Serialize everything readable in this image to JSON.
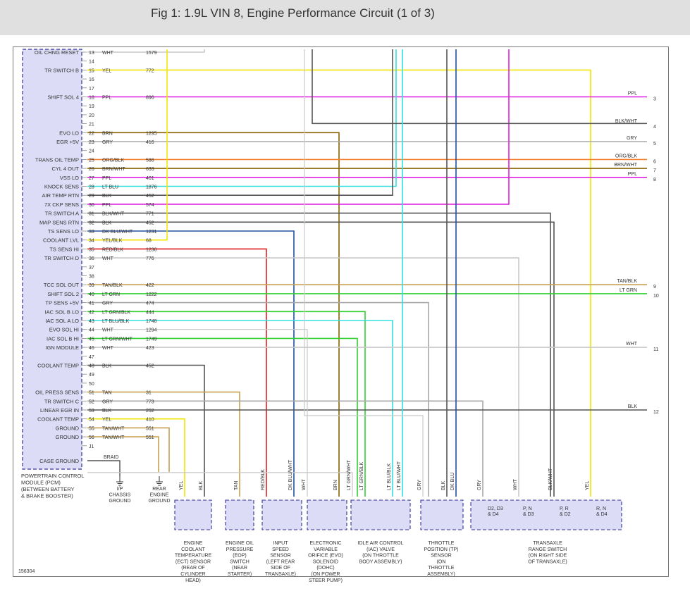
{
  "title": "Fig 1: 1.9L VIN 8, Engine Performance Circuit (1 of 3)",
  "figure_id": "156304",
  "pcm_label": [
    "POWERTRAIN CONTROL",
    "MODULE (PCM)",
    "(BETWEEN BATTERY",
    "& BRAKE BOOSTER)"
  ],
  "case_ground": "CASE GROUND",
  "braid": "BRAID",
  "pins": [
    {
      "n": "13",
      "label": "OIL CHNG RESET",
      "color": "WHT",
      "circuit": "1579"
    },
    {
      "n": "14",
      "label": "",
      "color": "",
      "circuit": ""
    },
    {
      "n": "15",
      "label": "TR SWITCH B",
      "color": "YEL",
      "circuit": "772"
    },
    {
      "n": "16",
      "label": "",
      "color": "",
      "circuit": ""
    },
    {
      "n": "17",
      "label": "",
      "color": "",
      "circuit": ""
    },
    {
      "n": "18",
      "label": "SHIFT SOL 4",
      "color": "PPL",
      "circuit": "896"
    },
    {
      "n": "19",
      "label": "",
      "color": "",
      "circuit": ""
    },
    {
      "n": "20",
      "label": "",
      "color": "",
      "circuit": ""
    },
    {
      "n": "21",
      "label": "",
      "color": "",
      "circuit": ""
    },
    {
      "n": "22",
      "label": "EVO LO",
      "color": "BRN",
      "circuit": "1295"
    },
    {
      "n": "23",
      "label": "EGR +5V",
      "color": "GRY",
      "circuit": "416"
    },
    {
      "n": "24",
      "label": "",
      "color": "",
      "circuit": ""
    },
    {
      "n": "25",
      "label": "TRANS OIL TEMP",
      "color": "ORG/BLK",
      "circuit": "586"
    },
    {
      "n": "26",
      "label": "CYL 4 OUT",
      "color": "BRN/WHT",
      "circuit": "633"
    },
    {
      "n": "27",
      "label": "VSS LO",
      "color": "PPL",
      "circuit": "401"
    },
    {
      "n": "28",
      "label": "KNOCK SENS",
      "color": "LT BLU",
      "circuit": "1876"
    },
    {
      "n": "29",
      "label": "AIR TEMP RTN",
      "color": "BLK",
      "circuit": "452"
    },
    {
      "n": "30",
      "label": "7X CKP SENS",
      "color": "PPL",
      "circuit": "574"
    },
    {
      "n": "31",
      "label": "TR SWITCH A",
      "color": "BLK/WHT",
      "circuit": "771"
    },
    {
      "n": "32",
      "label": "MAP SENS RTN",
      "color": "BLK",
      "circuit": "452"
    },
    {
      "n": "33",
      "label": "TS SENS LO",
      "color": "DK BLU/WHT",
      "circuit": "1231"
    },
    {
      "n": "34",
      "label": "COOLANT LVL",
      "color": "YEL/BLK",
      "circuit": "68"
    },
    {
      "n": "35",
      "label": "TS SENS HI",
      "color": "RED/BLK",
      "circuit": "1230"
    },
    {
      "n": "36",
      "label": "TR SWITCH D",
      "color": "WHT",
      "circuit": "776"
    },
    {
      "n": "37",
      "label": "",
      "color": "",
      "circuit": ""
    },
    {
      "n": "38",
      "label": "",
      "color": "",
      "circuit": ""
    },
    {
      "n": "39",
      "label": "TCC SOL OUT",
      "color": "TAN/BLK",
      "circuit": "422"
    },
    {
      "n": "40",
      "label": "SHIFT SOL 2",
      "color": "LT GRN",
      "circuit": "1222"
    },
    {
      "n": "41",
      "label": "TP SENS +5V",
      "color": "GRY",
      "circuit": "474"
    },
    {
      "n": "42",
      "label": "IAC SOL B LO",
      "color": "LT GRN/BLK",
      "circuit": "444"
    },
    {
      "n": "43",
      "label": "IAC SOL A LO",
      "color": "LT BLU/BLK",
      "circuit": "1748"
    },
    {
      "n": "44",
      "label": "EVO SOL HI",
      "color": "WHT",
      "circuit": "1294"
    },
    {
      "n": "45",
      "label": "IAC SOL B HI",
      "color": "LT GRN/WHT",
      "circuit": "1749"
    },
    {
      "n": "46",
      "label": "IGN MODULE",
      "color": "WHT",
      "circuit": "423"
    },
    {
      "n": "47",
      "label": "",
      "color": "",
      "circuit": ""
    },
    {
      "n": "48",
      "label": "COOLANT TEMP",
      "color": "BLK",
      "circuit": "452"
    },
    {
      "n": "49",
      "label": "",
      "color": "",
      "circuit": ""
    },
    {
      "n": "50",
      "label": "",
      "color": "",
      "circuit": ""
    },
    {
      "n": "51",
      "label": "OIL PRESS SENS",
      "color": "TAN",
      "circuit": "31"
    },
    {
      "n": "52",
      "label": "TR SWITCH C",
      "color": "GRY",
      "circuit": "773"
    },
    {
      "n": "53",
      "label": "LINEAR EGR IN",
      "color": "BLK",
      "circuit": "252"
    },
    {
      "n": "54",
      "label": "COOLANT TEMP",
      "color": "YEL",
      "circuit": "410"
    },
    {
      "n": "55",
      "label": "GROUND",
      "color": "TAN/WHT",
      "circuit": "551"
    },
    {
      "n": "56",
      "label": "GROUND",
      "color": "TAN/WHT",
      "circuit": "551"
    },
    {
      "n": "J1",
      "label": "",
      "color": "",
      "circuit": ""
    }
  ],
  "right_labels": [
    {
      "wire": "PPL",
      "ref": "3"
    },
    {
      "wire": "BLK/WHT",
      "ref": "4"
    },
    {
      "wire": "GRY",
      "ref": "5"
    },
    {
      "wire": "ORG/BLK",
      "ref": "6"
    },
    {
      "wire": "BRN/WHT",
      "ref": "7"
    },
    {
      "wire": "PPL",
      "ref": "8"
    },
    {
      "wire": "TAN/BLK",
      "ref": "9"
    },
    {
      "wire": "LT GRN",
      "ref": "10"
    },
    {
      "wire": "WHT",
      "ref": "11"
    },
    {
      "wire": "BLK",
      "ref": "12"
    }
  ],
  "grounds": [
    {
      "lines": [
        "I/P",
        "CHASSIS",
        "GROUND"
      ]
    },
    {
      "lines": [
        "REAR",
        "ENGINE",
        "GROUND"
      ]
    }
  ],
  "bottom_wire_labels": [
    "YEL",
    "BLK",
    "TAN",
    "RED/BLK",
    "DK BLU/WHT",
    "WHT",
    "BRN",
    "LT GRN/WHT",
    "LT GRN/BLK",
    "LT BLU/BLK",
    "LT BLU/WHT",
    "GRY",
    "BLK",
    "DK BLU",
    "GRY",
    "WHT",
    "BLK/WHT",
    "YEL"
  ],
  "components": [
    {
      "lines": [
        "ENGINE",
        "COOLANT",
        "TEMPERATURE",
        "(ECT) SENSOR",
        "(REAR OF",
        "CYLINDER",
        "HEAD)"
      ]
    },
    {
      "lines": [
        "ENGINE OIL",
        "PRESSURE",
        "(EOP)",
        "SWITCH",
        "(NEAR",
        "STARTER)"
      ]
    },
    {
      "lines": [
        "INPUT",
        "SPEED",
        "SENSOR",
        "(LEFT REAR",
        "SIDE OF",
        "TRANSAXLE)"
      ]
    },
    {
      "lines": [
        "ELECTRONIC",
        "VARIABLE",
        "ORIFICE (EVO)",
        "SOLENOID",
        "(DOHC)",
        "(ON POWER",
        "STEER PUMP)"
      ]
    },
    {
      "lines": [
        "IDLE AIR CONTROL",
        "(IAC) VALVE",
        "(ON THROTTLE",
        "BODY ASSEMBLY)"
      ]
    },
    {
      "lines": [
        "THROTTLE",
        "POSITION (TP)",
        "SENSOR",
        "(ON",
        "THROTTLE",
        "ASSEMBLY)"
      ]
    },
    {
      "lines": [
        "TRANSAXLE",
        "RANGE SWITCH",
        "(ON RIGHT SIDE",
        "OF TRANSAXLE)"
      ]
    }
  ],
  "switch_positions": [
    "D2, D3",
    "& D4",
    "P, N",
    "& D3",
    "P, R",
    "& D2",
    "R, N",
    "& D4"
  ],
  "colors": {
    "WHT": "#c8c8c8",
    "YEL": "#f2e600",
    "PPL": "#e020e0",
    "BRN": "#8a6400",
    "GRY": "#a8a8a8",
    "BLK": "#555555",
    "ORG": "#f08030",
    "LTBLU": "#30e0e0",
    "DKBLU": "#2050a0",
    "RED": "#e02020",
    "LTGRN": "#30d030",
    "TAN": "#c8a050",
    "PCM_FILL": "#dcdcf6",
    "PCM_BORDER": "#333399"
  }
}
